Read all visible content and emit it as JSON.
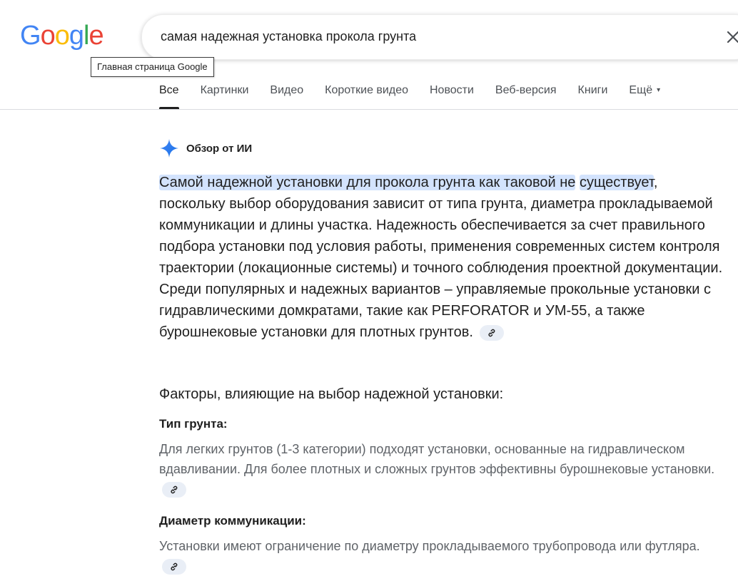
{
  "logo": {
    "letters": [
      {
        "char": "G",
        "color": "#4285F4"
      },
      {
        "char": "o",
        "color": "#EA4335"
      },
      {
        "char": "o",
        "color": "#FBBC05"
      },
      {
        "char": "g",
        "color": "#4285F4"
      },
      {
        "char": "l",
        "color": "#34A853"
      },
      {
        "char": "e",
        "color": "#EA4335"
      }
    ],
    "tooltip": "Главная страница Google"
  },
  "search": {
    "query": "самая надежная установка прокола грунта",
    "clear_icon": "close-icon"
  },
  "tabs": [
    {
      "label": "Все",
      "active": true
    },
    {
      "label": "Картинки"
    },
    {
      "label": "Видео"
    },
    {
      "label": "Короткие видео"
    },
    {
      "label": "Новости"
    },
    {
      "label": "Веб-версия"
    },
    {
      "label": "Книги"
    },
    {
      "label": "Ещё",
      "caret": "▾"
    }
  ],
  "ai_overview": {
    "icon": "sparkle-icon",
    "title": "Обзор от ИИ",
    "highlight_1": "Самой надежной установки для прокола грунта как таковой не",
    "highlight_2": "существует",
    "body": ", поскольку выбор оборудования зависит от типа грунта, диаметра прокладываемой коммуникации и длины участка. Надежность обеспечивается за счет правильного подбора установки под условия работы, применения современных систем контроля траектории (локационные системы) и точного соблюдения проектной документации. Среди популярных и надежных вариантов – управляемые прокольные установки с гидравлическими домкратами, такие как PERFORATOR и УМ-55, а также бурошнековые установки для плотных грунтов.",
    "factors_heading": "Факторы, влияющие на выбор надежной установки:",
    "sections": [
      {
        "heading": "Тип грунта:",
        "text": "Для легких грунтов (1-3 категории) подходят установки, основанные на гидравлическом вдавливании. Для более плотных и сложных грунтов эффективны бурошнековые установки."
      },
      {
        "heading": "Диаметр коммуникации:",
        "text": "Установки имеют ограничение по диаметру прокладываемого трубопровода или футляра."
      }
    ],
    "link_icon": "link-icon"
  }
}
